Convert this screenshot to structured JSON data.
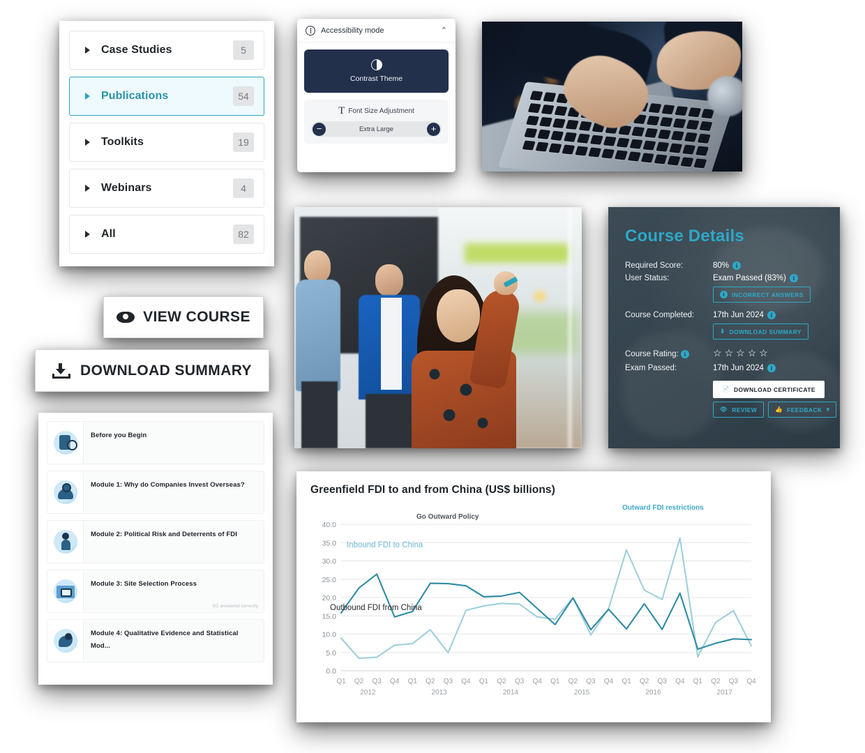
{
  "categories_card": {
    "items": [
      {
        "label": "Case Studies",
        "count": "5",
        "active": false
      },
      {
        "label": "Publications",
        "count": "54",
        "active": true
      },
      {
        "label": "Toolkits",
        "count": "19",
        "active": false
      },
      {
        "label": "Webinars",
        "count": "4",
        "active": false
      },
      {
        "label": "All",
        "count": "82",
        "active": false
      }
    ]
  },
  "accessibility": {
    "title": "Accessibility mode",
    "collapse_chevron": "⌃",
    "contrast_label": "Contrast Theme",
    "font_size_label": "Font Size Adjustment",
    "font_size_value": "Extra Large",
    "minus": "−",
    "plus": "+"
  },
  "buttons": {
    "view_course": "VIEW COURSE",
    "download_summary": "DOWNLOAD SUMMARY"
  },
  "modules": {
    "items": [
      {
        "title": "Before you Begin",
        "sub": ""
      },
      {
        "title": "Module 1: Why do Companies Invest Overseas?",
        "sub": ""
      },
      {
        "title": "Module 2: Political Risk and Deterrents of FDI",
        "sub": ""
      },
      {
        "title": "Module 3: Site Selection Process",
        "sub": "0/2 answered correctly"
      },
      {
        "title": "Module 4: Qualitative Evidence and Statistical Mod...",
        "sub": ""
      }
    ]
  },
  "course_details": {
    "title": "Course Details",
    "accent_color": "#2ea8c8",
    "rows": [
      {
        "key": "Required Score:",
        "value": "80%"
      },
      {
        "key": "User Status:",
        "value": "Exam Passed (83%)"
      },
      {
        "key": "Course Completed:",
        "value": "17th Jun 2024"
      },
      {
        "key": "Course Rating:",
        "value": ""
      },
      {
        "key": "Exam Passed:",
        "value": "17th Jun 2024"
      }
    ],
    "incorrect_answers_btn": "INCORRECT ANSWERS",
    "download_summary_btn": "DOWNLOAD SUMMARY",
    "download_certificate_btn": "DOWNLOAD CERTIFICATE",
    "review_btn": "REVIEW",
    "feedback_btn": "FEEDBACK",
    "feedback_caret": "▾",
    "rating_stars": 5,
    "rating_filled": 0,
    "star_glyph": "☆"
  },
  "chart_data": {
    "type": "line",
    "title": "Greenfield FDI to and from China (US$ billions)",
    "xlabel": "",
    "ylabel": "",
    "ylim": [
      0,
      40
    ],
    "yticks": [
      "0.0",
      "5.0",
      "10.0",
      "15.0",
      "20.0",
      "25.0",
      "30.0",
      "35.0",
      "40.0"
    ],
    "grid": true,
    "legend": "inline-annotations",
    "x": [
      "Q1",
      "Q2",
      "Q3",
      "Q4",
      "Q1",
      "Q2",
      "Q3",
      "Q4",
      "Q1",
      "Q2",
      "Q3",
      "Q4",
      "Q1",
      "Q2",
      "Q3",
      "Q4",
      "Q1",
      "Q2",
      "Q3",
      "Q4",
      "Q1",
      "Q2",
      "Q3",
      "Q4"
    ],
    "year_groups": [
      {
        "label": "2012",
        "span": 4
      },
      {
        "label": "2013",
        "span": 4
      },
      {
        "label": "2014",
        "span": 4
      },
      {
        "label": "2015",
        "span": 4
      },
      {
        "label": "2016",
        "span": 4
      },
      {
        "label": "2017",
        "span": 4
      }
    ],
    "series": [
      {
        "name": "Outbound FDI from China",
        "color": "#2f8ba3",
        "values": [
          15.8,
          22.6,
          26.4,
          14.7,
          16.2,
          23.9,
          23.8,
          23.2,
          20.2,
          20.4,
          21.4,
          17.0,
          12.6,
          19.9,
          11.2,
          16.8,
          11.4,
          18.3,
          11.3,
          21.2,
          5.9,
          7.5,
          8.7,
          8.5
        ]
      },
      {
        "name": "Inbound FDI to China",
        "color": "#9ecfdd",
        "values": [
          8.9,
          3.4,
          3.7,
          7.0,
          7.4,
          11.2,
          4.9,
          16.5,
          17.7,
          18.4,
          18.2,
          14.7,
          14.1,
          19.9,
          9.8,
          17.0,
          33.0,
          22.0,
          19.5,
          36.3,
          3.8,
          13.2,
          16.4,
          6.8
        ]
      }
    ],
    "annotations": [
      {
        "text": "Go Outward Policy",
        "color": "#4c555c"
      },
      {
        "text": "Outward FDI restrictions",
        "color": "#3fa8cc"
      },
      {
        "text": "Inbound FDI to China",
        "color": "#6fb9d6"
      },
      {
        "text": "Outbound FDI from China",
        "color": "#1d2328"
      }
    ]
  }
}
